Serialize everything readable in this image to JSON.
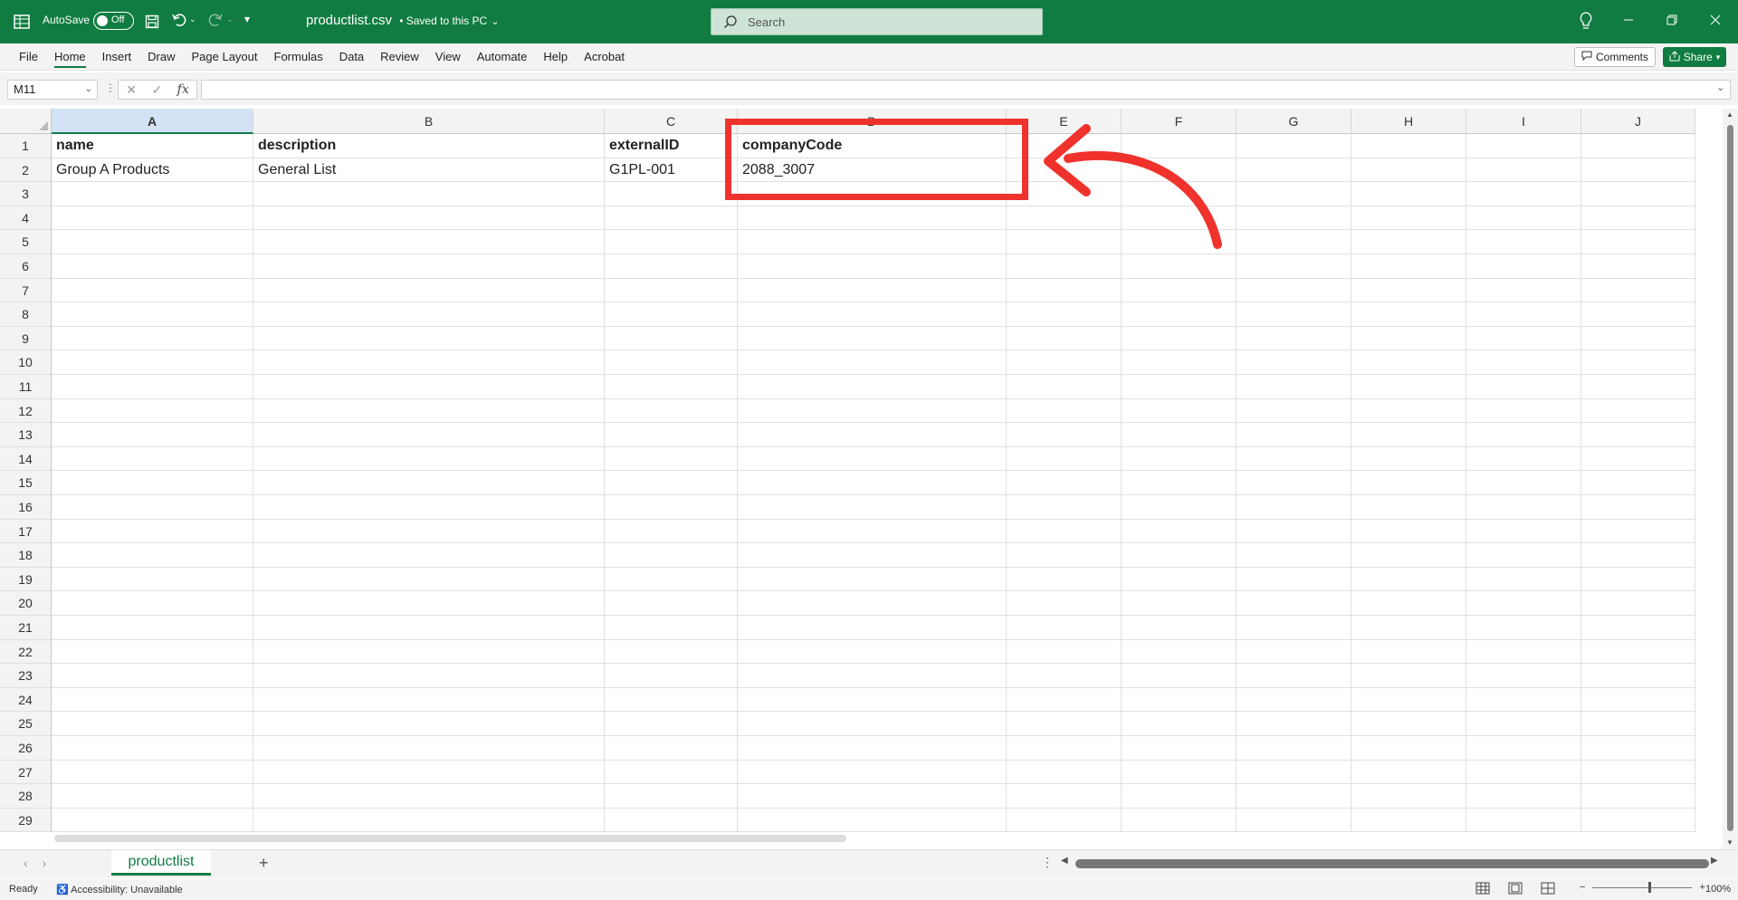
{
  "titlebar": {
    "autosave_label": "AutoSave",
    "autosave_state": "Off",
    "filename": "productlist.csv",
    "saved_status": "• Saved to this PC",
    "search_placeholder": "Search"
  },
  "menu": {
    "items": [
      "File",
      "Home",
      "Insert",
      "Draw",
      "Page Layout",
      "Formulas",
      "Data",
      "Review",
      "View",
      "Automate",
      "Help",
      "Acrobat"
    ],
    "active": "Home",
    "comments_label": "Comments",
    "share_label": "Share"
  },
  "formula_bar": {
    "name_box": "M11",
    "fx_symbol": "fx",
    "formula": ""
  },
  "columns": [
    "A",
    "B",
    "C",
    "D",
    "E",
    "F",
    "G",
    "H",
    "I",
    "J"
  ],
  "rows": [
    1,
    2,
    3,
    4,
    5,
    6,
    7,
    8,
    9,
    10,
    11,
    12,
    13,
    14,
    15,
    16,
    17,
    18,
    19,
    20,
    21,
    22,
    23,
    24,
    25,
    26,
    27,
    28,
    29
  ],
  "cells": {
    "A1": "name",
    "B1": "description",
    "C1": "externalID",
    "D1": "companyCode",
    "A2": "Group A Products",
    "B2": "General List",
    "C2": "G1PL-001",
    "D2": "2088_3007"
  },
  "sheet_tabs": {
    "active": "productlist"
  },
  "status": {
    "ready": "Ready",
    "accessibility": "Accessibility: Unavailable",
    "zoom": "100%"
  },
  "colors": {
    "excel_green": "#107c41",
    "annotation_red": "#f0322d"
  }
}
